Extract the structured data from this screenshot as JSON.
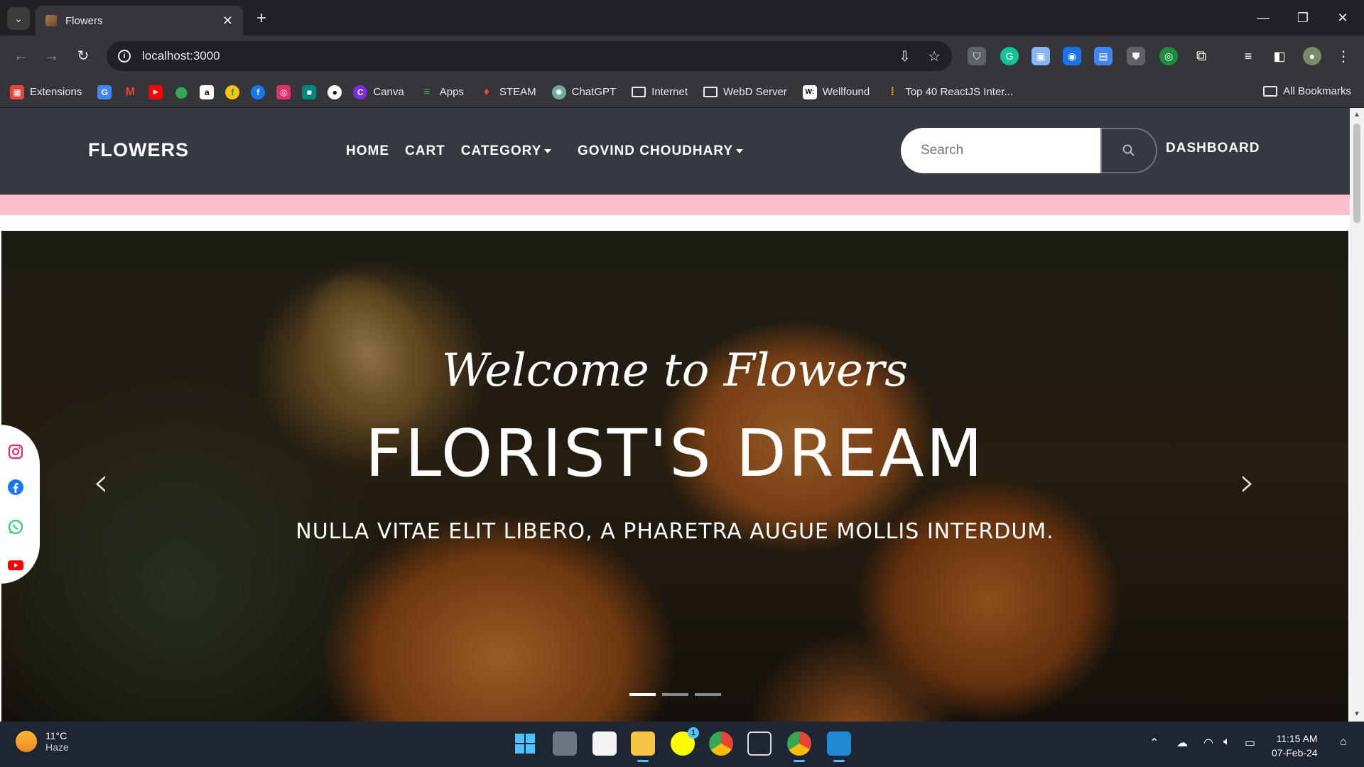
{
  "browser": {
    "tab_title": "Flowers",
    "url": "localhost:3000",
    "bookmarks": [
      {
        "label": "Extensions",
        "icon": "extensions-icon",
        "color": "#e8453c"
      },
      {
        "label": "",
        "icon": "google-translate-icon",
        "color": "#4285f4"
      },
      {
        "label": "",
        "icon": "gmail-icon",
        "color": "#ea4335"
      },
      {
        "label": "",
        "icon": "youtube-icon",
        "color": "#ff0000"
      },
      {
        "label": "",
        "icon": "maps-icon",
        "color": "#34a853"
      },
      {
        "label": "",
        "icon": "amazon-icon",
        "color": "#ffffff"
      },
      {
        "label": "",
        "icon": "flipkart-icon",
        "color": "#f7c600"
      },
      {
        "label": "",
        "icon": "facebook-icon",
        "color": "#1877f2"
      },
      {
        "label": "",
        "icon": "instagram-icon",
        "color": "#e1306c"
      },
      {
        "label": "",
        "icon": "meet-icon",
        "color": "#00897b"
      },
      {
        "label": "",
        "icon": "github-icon",
        "color": "#ffffff"
      },
      {
        "label": "Canva",
        "icon": "canva-icon",
        "color": "#7d2ae8"
      },
      {
        "label": "Apps",
        "icon": "apps-icon",
        "color": "#34a853"
      },
      {
        "label": "STEAM",
        "icon": "steam-icon",
        "color": "#e8453c"
      },
      {
        "label": "ChatGPT",
        "icon": "chatgpt-icon",
        "color": "#74aa9c"
      },
      {
        "label": "Internet",
        "icon": "folder-icon",
        "color": ""
      },
      {
        "label": "WebD Server",
        "icon": "folder-icon",
        "color": ""
      },
      {
        "label": "Wellfound",
        "icon": "wellfound-icon",
        "color": "#ffffff"
      },
      {
        "label": "Top 40 ReactJS Inter...",
        "icon": "bookmark-page-icon",
        "color": "#f4b400"
      }
    ],
    "all_bookmarks": "All Bookmarks"
  },
  "site": {
    "brand": "FLOWERS",
    "nav": {
      "home": "HOME",
      "cart": "CART",
      "category": "CATEGORY",
      "user": "GOVIND CHOUDHARY",
      "dashboard": "DASHBOARD"
    },
    "search_placeholder": "Search",
    "hero": {
      "welcome": "Welcome to Flowers",
      "headline": "FLORIST'S DREAM",
      "subline": "NULLA VITAE ELIT LIBERO, A PHARETRA AUGUE MOLLIS INTERDUM.",
      "active_slide": 1,
      "slide_count": 3
    },
    "social": [
      "instagram-icon",
      "facebook-icon",
      "whatsapp-icon",
      "youtube-icon"
    ],
    "strip_color": "#ffc0cb"
  },
  "taskbar": {
    "weather_temp": "11°C",
    "weather_cond": "Haze",
    "time": "11:15 AM",
    "date": "07-Feb-24",
    "snapchat_badge": "1"
  }
}
